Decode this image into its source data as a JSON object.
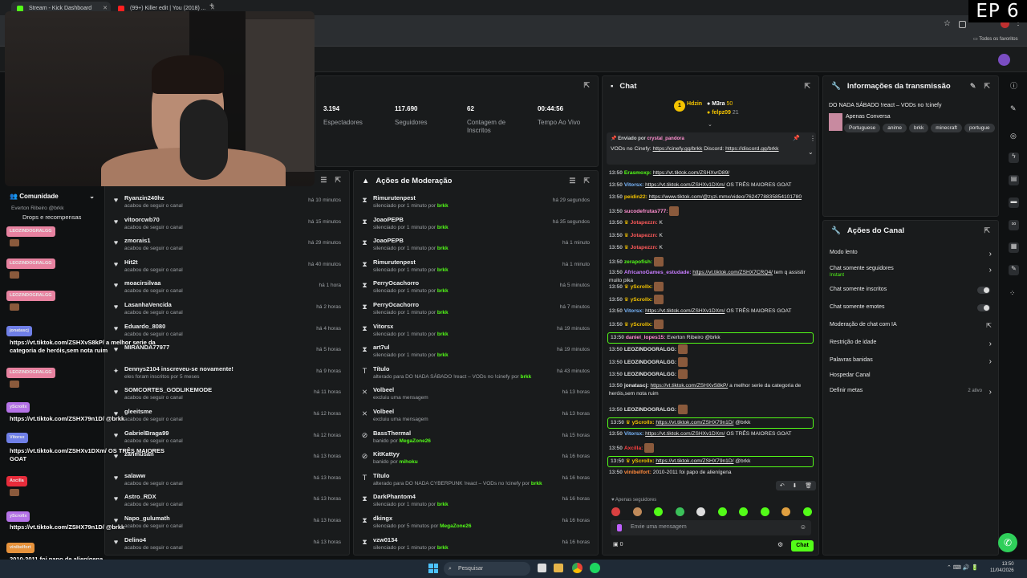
{
  "browser": {
    "tabs": [
      {
        "label": "Stream - Kick Dashboard"
      },
      {
        "label": "(99+) Killer edit | You (2018) ..."
      }
    ],
    "bookmarks_label": "Todos os favoritos"
  },
  "episode_label": "EP 6",
  "colors": {
    "accent": "#53fc18",
    "panel": "#191b1c",
    "bg": "#0f1112"
  },
  "stats": {
    "items": [
      {
        "value": "3.194",
        "label": "Espectadores"
      },
      {
        "value": "117.690",
        "label": "Seguidores"
      },
      {
        "value": "62",
        "label": "Contagem de Inscritos"
      },
      {
        "value": "00:44:56",
        "label": "Tempo Ao Vivo"
      }
    ]
  },
  "community": {
    "title": "Comunidade",
    "owner": "Everton Ribeiro @brkk",
    "drops": "Drops e recompensas"
  },
  "activity": {
    "rows": [
      {
        "name": "Ryanzin240hz",
        "action": "acabou de seguir o canal",
        "time": "há 10 minutos"
      },
      {
        "name": "vitoorcwb70",
        "action": "acabou de seguir o canal",
        "time": "há 15 minutos"
      },
      {
        "name": "zmorais1",
        "action": "acabou de seguir o canal",
        "time": "há 29 minutos"
      },
      {
        "name": "Hit2t",
        "action": "acabou de seguir o canal",
        "time": "há 40 minutos"
      },
      {
        "name": "moacirsilvaa",
        "action": "acabou de seguir o canal",
        "time": "há 1 hora"
      },
      {
        "name": "LasanhaVencida",
        "action": "acabou de seguir o canal",
        "time": "há 2 horas"
      },
      {
        "name": "Eduardo_8080",
        "action": "acabou de seguir o canal",
        "time": "há 4 horas"
      },
      {
        "name": "MIRANDA77977",
        "action": "",
        "time": "há 5 horas"
      },
      {
        "name": "Dennys2104 inscreveu-se novamente!",
        "action": "eles foram inscritos por 5 meses",
        "time": "há 9 horas"
      },
      {
        "name": "SOMCORTES_GODLIKEMODE",
        "action": "acabou de seguir o canal",
        "time": "há 11 horas"
      },
      {
        "name": "gleeitsme",
        "action": "acabou de seguir o canal",
        "time": "há 12 horas"
      },
      {
        "name": "GabrielBraga99",
        "action": "acabou de seguir o canal",
        "time": "há 12 horas"
      },
      {
        "name": "zanmusan",
        "action": "",
        "time": "há 13 horas"
      },
      {
        "name": "salaww",
        "action": "acabou de seguir o canal",
        "time": "há 13 horas"
      },
      {
        "name": "Astro_RDX",
        "action": "acabou de seguir o canal",
        "time": "há 13 horas"
      },
      {
        "name": "Napo_gulumath",
        "action": "acabou de seguir o canal",
        "time": "há 13 horas"
      },
      {
        "name": "Delino4",
        "action": "acabou de seguir o canal",
        "time": "há 13 horas"
      }
    ]
  },
  "moderation": {
    "title": "Ações de Moderação",
    "rows": [
      {
        "name": "Rimurutenpest",
        "action": "silenciado por 1 minuto por",
        "by": "brkk",
        "time": "há 29 segundos",
        "icon": "timer"
      },
      {
        "name": "JoaoPEPB",
        "action": "silenciado por 1 minuto por",
        "by": "brkk",
        "time": "há 35 segundos",
        "icon": "timer"
      },
      {
        "name": "JoaoPEPB",
        "action": "silenciado por 1 minuto por",
        "by": "brkk",
        "time": "há 1 minuto",
        "icon": "timer"
      },
      {
        "name": "Rimurutenpest",
        "action": "silenciado por 1 minuto por",
        "by": "brkk",
        "time": "há 1 minuto",
        "icon": "timer"
      },
      {
        "name": "PerryOcachorro",
        "action": "silenciado por 1 minuto por",
        "by": "brkk",
        "time": "há 5 minutos",
        "icon": "timer"
      },
      {
        "name": "PerryOcachorro",
        "action": "silenciado por 1 minuto por",
        "by": "brkk",
        "time": "há 7 minutos",
        "icon": "timer"
      },
      {
        "name": "Vitorsx",
        "action": "silenciado por 1 minuto por",
        "by": "brkk",
        "time": "há 19 minutos",
        "icon": "timer"
      },
      {
        "name": "art7ul",
        "action": "silenciado por 1 minuto por",
        "by": "brkk",
        "time": "há 19 minutos",
        "icon": "timer"
      },
      {
        "name": "Título",
        "action": "alterado para DO NADA SÁBADO !react – VODs no !cinefy por",
        "by": "brkk",
        "time": "há 43 minutos",
        "icon": "title"
      },
      {
        "name": "Volbeel",
        "action": "excluiu uma mensagem",
        "by": "",
        "time": "há 13 horas",
        "icon": "delete"
      },
      {
        "name": "Volbeel",
        "action": "excluiu uma mensagem",
        "by": "",
        "time": "há 13 horas",
        "icon": "delete"
      },
      {
        "name": "BassThermal",
        "action": "banido por",
        "by": "MegaZone26",
        "time": "há 15 horas",
        "icon": "ban"
      },
      {
        "name": "KitKattyy",
        "action": "banido por",
        "by": "mihoku",
        "time": "há 16 horas",
        "icon": "ban"
      },
      {
        "name": "Título",
        "action": "alterado para DO NADA CYBERPUNK !react – VODs no !cinefy por",
        "by": "brkk",
        "time": "há 16 horas",
        "icon": "title"
      },
      {
        "name": "DarkPhantom4",
        "action": "silenciado por 1 minuto por",
        "by": "brkk",
        "time": "há 16 horas",
        "icon": "timer"
      },
      {
        "name": "dkingx",
        "action": "silenciado por 5 minutos por",
        "by": "MegaZone26",
        "time": "há 16 horas",
        "icon": "timer"
      },
      {
        "name": "vzw0134",
        "action": "silenciado por 1 minuto por",
        "by": "brkk",
        "time": "há 16 horas",
        "icon": "timer"
      }
    ]
  },
  "chat": {
    "title": "Chat",
    "top_users": [
      {
        "name": "Hdzin",
        "count": "1"
      },
      {
        "name": "M3ra",
        "count": "50"
      },
      {
        "name": "felpz09",
        "count": "21"
      }
    ],
    "pinned": {
      "label": "Enviado por",
      "user": "crystal_pandora",
      "text": "VODs no Cinefy:",
      "link1": "https://cinefy.gg/brkk",
      "mid": "Discord:",
      "link2": "https://discord.gg/brkk"
    },
    "messages": [
      {
        "ts": "13:50",
        "user": "Erasmoxp:",
        "link": "https://vt.tiktok.com/ZSHXvrD89/",
        "text": "",
        "color": "#53fc18"
      },
      {
        "ts": "13:50",
        "user": "Vitorsx:",
        "link": "https://vt.tiktok.com/ZSHXv1DXm/",
        "text": "OS TRÊS MAIORES GOAT",
        "color": "#7ab8ff"
      },
      {
        "ts": "13:50",
        "user": "peidin22:",
        "link": "https://www.tiktok.com/@zyzi.mmx/video/7624778835854101780",
        "text": "",
        "color": "#f5c400"
      },
      {
        "ts": "13:50",
        "user": "sucodefrutas777:",
        "link": "",
        "text": "",
        "color": "#ff8fd0"
      },
      {
        "ts": "13:50",
        "user": "Jotapezzn:",
        "link": "",
        "text": "K",
        "color": "#ff5a5a"
      },
      {
        "ts": "13:50",
        "user": "Jotapezzn:",
        "link": "",
        "text": "K",
        "color": "#ff5a5a"
      },
      {
        "ts": "13:50",
        "user": "Jotapezzn:",
        "link": "",
        "text": "K",
        "color": "#ff5a5a"
      },
      {
        "ts": "13:50",
        "user": "zerapofish:",
        "link": "",
        "text": "",
        "color": "#53fc18"
      },
      {
        "ts": "13:50",
        "user": "AfricanoGames_estudade:",
        "link": "https://vt.tiktok.com/ZSHX7CRQ4/",
        "text": "tem q assistir muito pika",
        "color": "#c77dff"
      },
      {
        "ts": "13:50",
        "user": "yScrollx:",
        "link": "",
        "text": "",
        "color": "#f5c400"
      },
      {
        "ts": "13:50",
        "user": "yScrollx:",
        "link": "",
        "text": "",
        "color": "#f5c400"
      },
      {
        "ts": "13:50",
        "user": "Vitorsx:",
        "link": "https://vt.tiktok.com/ZSHXv1DXm/",
        "text": "OS TRÊS MAIORES GOAT",
        "color": "#7ab8ff"
      },
      {
        "ts": "13:50",
        "user": "yScrollx:",
        "link": "",
        "text": "",
        "color": "#f5c400"
      },
      {
        "ts": "13:50",
        "user": "daniel_lopes15:",
        "link": "",
        "text": "Everton Ribeiro @brkk",
        "color": "#ff8fd0"
      },
      {
        "ts": "13:50",
        "user": "LEOZINDOGRALGG:",
        "link": "",
        "text": "",
        "color": "#e6e7e8"
      },
      {
        "ts": "13:50",
        "user": "LEOZINDOGRALGG:",
        "link": "",
        "text": "",
        "color": "#e6e7e8"
      },
      {
        "ts": "13:50",
        "user": "LEOZINDOGRALGG:",
        "link": "",
        "text": "",
        "color": "#e6e7e8"
      },
      {
        "ts": "13:50",
        "user": "jonatascj:",
        "link": "https://vt.tiktok.com/ZSHXvS8kP/",
        "text": "a melhor serie da categoria de heróis,sem nota ruim",
        "color": "#e6e7e8"
      },
      {
        "ts": "13:50",
        "user": "LEOZINDOGRALGG:",
        "link": "",
        "text": "",
        "color": "#e6e7e8"
      },
      {
        "ts": "13:50",
        "user": "yScrollx:",
        "link": "https://vt.tiktok.com/ZSHX79n1D/",
        "text": "@brkk",
        "color": "#f5c400"
      },
      {
        "ts": "13:50",
        "user": "Vitorsx:",
        "link": "https://vt.tiktok.com/ZSHXv1DXm/",
        "text": "OS TRÊS MAIORES GOAT",
        "color": "#7ab8ff"
      },
      {
        "ts": "13:50",
        "user": "Axcilla:",
        "link": "",
        "text": "",
        "color": "#ff4040"
      },
      {
        "ts": "13:50",
        "user": "yScrollx:",
        "link": "https://vt.tiktok.com/ZSHX79n1D/",
        "text": "@brkk",
        "color": "#f5c400"
      },
      {
        "ts": "13:50",
        "user": "vinibelfort:",
        "link": "",
        "text": "2010-2011 foi papo de alienígena",
        "color": "#ff8a3c"
      }
    ],
    "mode_label": "Apenas seguidores",
    "input_placeholder": "Envie uma mensagem",
    "count": "0",
    "send_label": "Chat"
  },
  "stream_info": {
    "title": "Informações da transmissão",
    "stream_title": "DO NADA SÁBADO !react – VODs no !cinefy",
    "category": "Apenas Conversa",
    "tags": [
      "Portuguese",
      "anime",
      "brkk",
      "minecraft",
      "portugue"
    ]
  },
  "channel_actions": {
    "title": "Ações do Canal",
    "items": [
      {
        "label": "Modo lento",
        "sub": "",
        "control": "chevron"
      },
      {
        "label": "Chat somente seguidores",
        "sub": "Instant",
        "control": "chevron"
      },
      {
        "label": "Chat somente inscritos",
        "sub": "",
        "control": "toggle"
      },
      {
        "label": "Chat somente emotes",
        "sub": "",
        "control": "toggle"
      },
      {
        "label": "Moderação de chat com IA",
        "sub": "",
        "control": "external"
      },
      {
        "label": "Restrição de idade",
        "sub": "",
        "control": "chevron"
      },
      {
        "label": "Palavras banidas",
        "sub": "",
        "control": "chevron"
      },
      {
        "label": "Hospedar Canal",
        "sub": "",
        "control": "none"
      },
      {
        "label": "Definir metas",
        "sub": "2 ativo",
        "control": "chevron"
      }
    ]
  },
  "overlay": {
    "messages": [
      {
        "user": "LEOZINDOGRALGG",
        "text": "",
        "color": "#ff8fb0"
      },
      {
        "user": "LEOZINDOGRALGG",
        "text": "",
        "color": "#ff8fb0"
      },
      {
        "user": "LEOZINDOGRALGG",
        "text": "",
        "color": "#ff8fb0"
      },
      {
        "user": "jonatascj",
        "text": "https://vt.tiktok.com/ZSHXvS8kP/ a melhor serie da categoria de heróis,sem nota ruim",
        "color": "#7a8cff"
      },
      {
        "user": "LEOZINDOGRALGG",
        "text": "",
        "color": "#ff8fb0"
      },
      {
        "user": "yScrollx",
        "text": "https://vt.tiktok.com/ZSHX79n1D/ @brkk",
        "color": "#c77dff"
      },
      {
        "user": "Vitorsx",
        "text": "https://vt.tiktok.com/ZSHXv1DXm/ OS TRÊS MAIORES GOAT",
        "color": "#7a8cff"
      },
      {
        "user": "Axcilla",
        "text": "",
        "color": "#ff3040"
      },
      {
        "user": "yScrollx",
        "text": "https://vt.tiktok.com/ZSHX79n1D/ @brkk",
        "color": "#c77dff"
      },
      {
        "user": "vinibelfort",
        "text": "2010-2011 foi papo de alienígena",
        "color": "#ffa040"
      }
    ]
  },
  "taskbar": {
    "search_label": "Pesquisar",
    "time": "13:50",
    "date": "11/04/2026"
  }
}
